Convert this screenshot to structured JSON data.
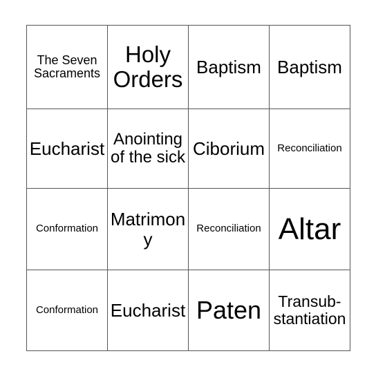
{
  "card": {
    "type": "bingo-card",
    "rows": 4,
    "columns": 4,
    "border_color": "#555555",
    "background_color": "#ffffff",
    "text_color": "#000000",
    "cells": [
      {
        "text": "The Seven Sacraments",
        "row": 0,
        "col": 0,
        "size": "fs-sm"
      },
      {
        "text": "Holy Orders",
        "row": 0,
        "col": 1,
        "size": "fs-2xl"
      },
      {
        "text": "Baptism",
        "row": 0,
        "col": 2,
        "size": "fs-xl"
      },
      {
        "text": "Baptism",
        "row": 0,
        "col": 3,
        "size": "fs-xl"
      },
      {
        "text": "Eucharist",
        "row": 1,
        "col": 0,
        "size": "fs-xl"
      },
      {
        "text": "Anointing of the sick",
        "row": 1,
        "col": 1,
        "size": "fs-lg"
      },
      {
        "text": "Ciborium",
        "row": 1,
        "col": 2,
        "size": "fs-xl"
      },
      {
        "text": "Reconciliation",
        "row": 1,
        "col": 3,
        "size": "fs-xs"
      },
      {
        "text": "Conformation",
        "row": 2,
        "col": 0,
        "size": "fs-xs"
      },
      {
        "text": "Matrimony",
        "row": 2,
        "col": 1,
        "size": "fs-xl"
      },
      {
        "text": "Reconciliation",
        "row": 2,
        "col": 2,
        "size": "fs-xs"
      },
      {
        "text": "Altar",
        "row": 2,
        "col": 3,
        "size": "fs-4xl"
      },
      {
        "text": "Conformation",
        "row": 3,
        "col": 0,
        "size": "fs-xs"
      },
      {
        "text": "Eucharist",
        "row": 3,
        "col": 1,
        "size": "fs-xl"
      },
      {
        "text": "Paten",
        "row": 3,
        "col": 2,
        "size": "fs-3xl"
      },
      {
        "text": "Transub-stantiation",
        "row": 3,
        "col": 3,
        "size": "fs-md"
      }
    ]
  }
}
